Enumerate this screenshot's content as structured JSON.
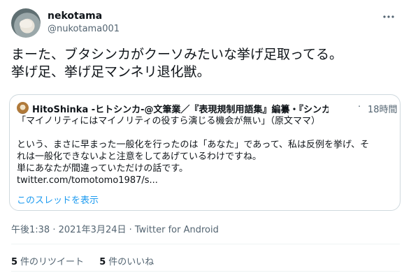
{
  "author": {
    "display_name": "nekotama",
    "handle": "@nukotama001",
    "avatar_icon": "cat-avatar-icon"
  },
  "more_icon": "more-dots-icon",
  "tweet_text_lines": [
    "まーた、ブタシンカがクーソみたいな挙げ足取ってる。",
    "挙げ足、挙げ足マンネリ退化獣。"
  ],
  "quote": {
    "author_name": "HitoShinka -ヒトシンカ-@文筆業／『表現規制用語集』編纂・『シンカ...",
    "dot": "·",
    "time": "18時間",
    "lines": [
      "「マイノリティにはマイノリティの役すら演じる機会が無い」（原文ママ）",
      "",
      "という、まさに早まった一般化を行ったのは「あなた」であって、私は反例を挙げ、そ",
      "れは一般化できないよと注意をしてあげているわけですね。",
      "単にあなたが間違っていただけの話です。",
      "twitter.com/tomotomo1987/s..."
    ],
    "show_thread": "このスレッドを表示"
  },
  "meta": {
    "timestamp": "午後1:38 · 2021年3月24日 · Twitter for Android"
  },
  "stats": {
    "retweets_count": "5",
    "retweets_label": "件のリツイート",
    "likes_count": "5",
    "likes_label": "件のいいね"
  },
  "colors": {
    "text": "#0f1419",
    "secondary": "#536471",
    "link": "#1d9bf0",
    "border": "#cfd9de"
  }
}
